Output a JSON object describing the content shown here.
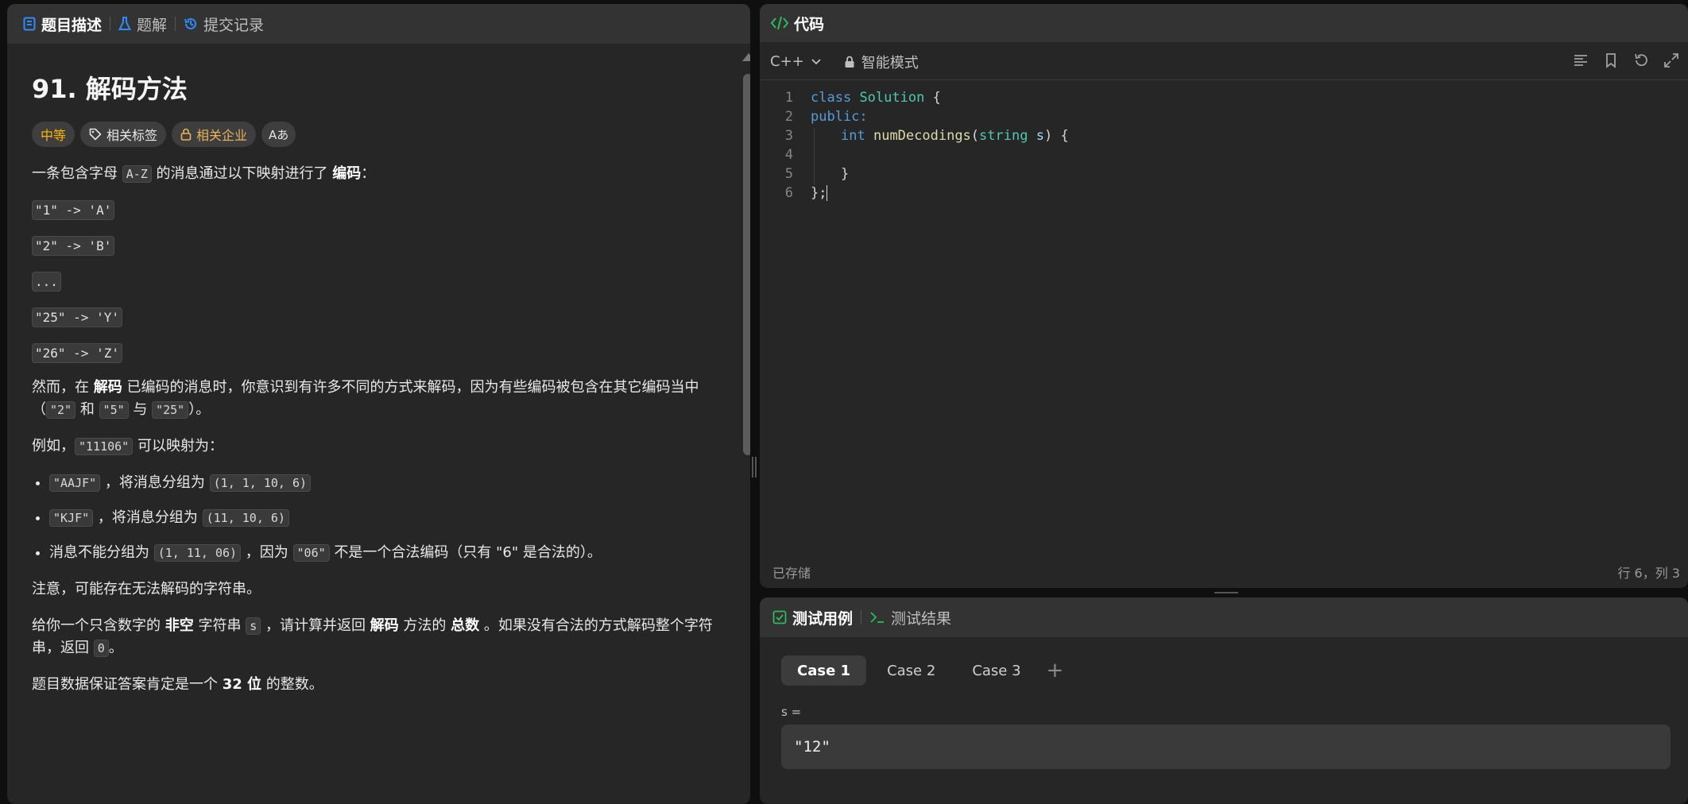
{
  "left_tabs": [
    {
      "label": "题目描述",
      "icon": "document-icon"
    },
    {
      "label": "题解",
      "icon": "flask-icon"
    },
    {
      "label": "提交记录",
      "icon": "history-icon"
    }
  ],
  "problem": {
    "title": "91. 解码方法",
    "pills": {
      "difficulty": "中等",
      "tags": "相关标签",
      "companies": "相关企业",
      "translate": "Aあ"
    },
    "intro": {
      "before": "一条包含字母 ",
      "code": "A-Z",
      "middle": " 的消息通过以下映射进行了 ",
      "bold": "编码",
      "after": "："
    },
    "mappings": [
      "\"1\" -> 'A'",
      "\"2\" -> 'B'",
      "...",
      "\"25\" -> 'Y'",
      "\"26\" -> 'Z'"
    ],
    "p2": {
      "a": "然而，在 ",
      "b": "解码",
      "c": " 已编码的消息时，你意识到有许多不同的方式来解码，因为有些编码被包含在其它编码当中（",
      "code1": "\"2\"",
      "d": " 和 ",
      "code2": "\"5\"",
      "e": " 与 ",
      "code3": "\"25\"",
      "f": "）。"
    },
    "p3": {
      "a": "例如，",
      "code": "\"11106\"",
      "b": " 可以映射为："
    },
    "bullets": [
      {
        "code": "\"AAJF\"",
        "text": " ，将消息分组为 ",
        "code2": "(1, 1, 10, 6)"
      },
      {
        "code": "\"KJF\"",
        "text": " ，将消息分组为 ",
        "code2": "(11, 10, 6)"
      }
    ],
    "bullet3": {
      "a": "消息不能分组为 ",
      "code": "(1, 11, 06)",
      "b": " ，因为 ",
      "code2": "\"06\"",
      "c": " 不是一个合法编码（只有 \"6\" 是合法的）。"
    },
    "p4": "注意，可能存在无法解码的字符串。",
    "p5": {
      "a": "给你一个只含数字的 ",
      "b": "非空",
      "c": " 字符串 ",
      "code": "s",
      "d": " ，请计算并返回 ",
      "e": "解码",
      "f": " 方法的 ",
      "g": "总数",
      "h": " 。如果没有合法的方式解码整个字符串，返回 ",
      "code2": "0",
      "i": "。"
    },
    "p6": {
      "a": "题目数据保证答案肯定是一个 ",
      "b": "32 位",
      "c": " 的整数。"
    }
  },
  "code_panel": {
    "tab_label": "代码",
    "language": "C++",
    "mode": "智能模式",
    "line_numbers": [
      "1",
      "2",
      "3",
      "4",
      "5",
      "6"
    ],
    "saved": "已存储",
    "position": "行 6，列 3"
  },
  "code_tokens": {
    "class_kw": "class",
    "class_name": "Solution",
    "brace_open": " {",
    "public_kw": "public:",
    "int_kw": "int",
    "func": "numDecodings",
    "paren_open": "(",
    "string_ty": "string",
    "param": "s",
    "paren_close": ") {",
    "close_inner": "}",
    "close_outer": "};"
  },
  "test_panel": {
    "tab_cases": "测试用例",
    "tab_results": "测试结果",
    "cases": [
      "Case 1",
      "Case 2",
      "Case 3"
    ],
    "add": "+",
    "var_label": "s =",
    "var_value": "\"12\""
  },
  "colors": {
    "accent_green": "#2cbb5d",
    "medium": "#ffb800",
    "keyword": "#569cd6",
    "type": "#4ec9b0",
    "function": "#dcdcaa"
  }
}
